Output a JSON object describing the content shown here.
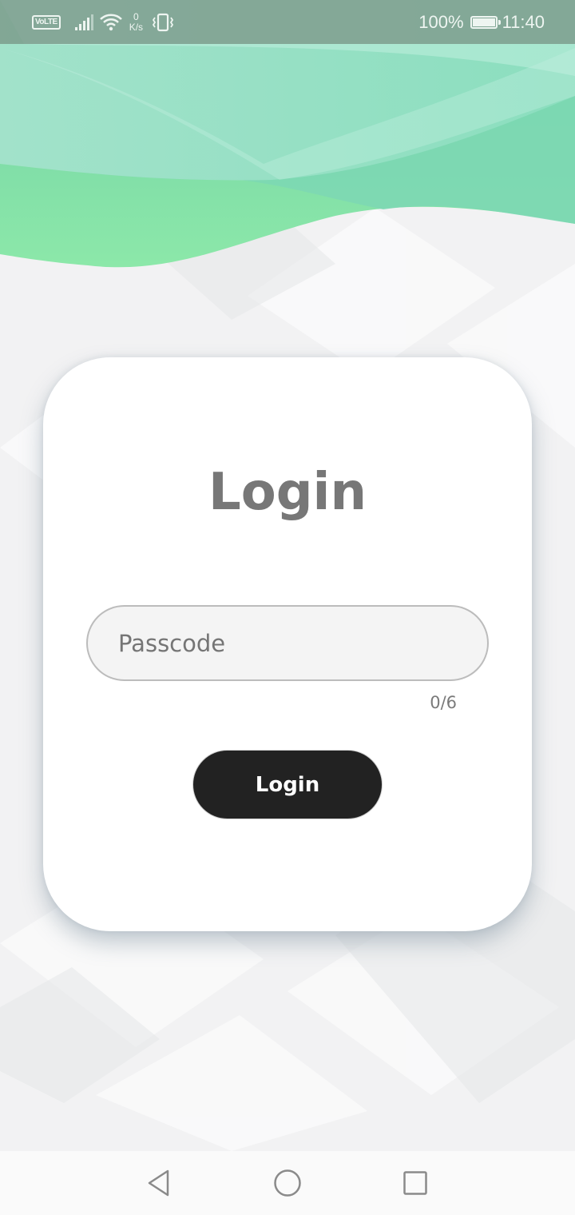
{
  "status_bar": {
    "volte_label": "VoLTE",
    "net_speed_value": "0",
    "net_speed_unit": "K/s",
    "battery_percent_label": "100%",
    "battery_level": 1.0,
    "time": "11:40",
    "icons": [
      "volte-icon",
      "signal-icon",
      "wifi-icon",
      "vibrate-icon",
      "battery-icon"
    ]
  },
  "login_card": {
    "title": "Login",
    "passcode_placeholder": "Passcode",
    "passcode_value": "",
    "char_counter": "0/6",
    "button_label": "Login"
  },
  "nav_bar": {
    "icons": [
      "back-icon",
      "home-icon",
      "recents-icon"
    ]
  },
  "colors": {
    "header_green": "#7fdcae",
    "header_green_light": "#a8e6cc",
    "button_dark": "#222222",
    "title_gray": "#777777",
    "status_bar": "#7f978a"
  }
}
